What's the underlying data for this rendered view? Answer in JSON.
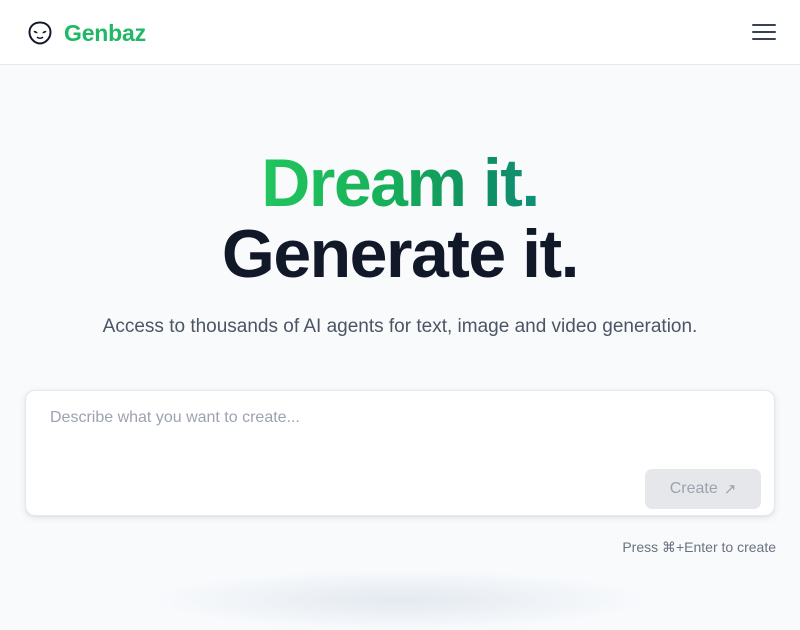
{
  "header": {
    "brand_name": "Genbaz",
    "logo_icon": "alien-face-icon",
    "menu_icon": "hamburger-menu-icon"
  },
  "hero": {
    "line1": "Dream it.",
    "line2": "Generate it.",
    "subtitle": "Access to thousands of AI agents for text, image and video generation."
  },
  "prompt": {
    "placeholder": "Describe what you want to create...",
    "value": "",
    "create_label": "Create",
    "create_icon": "arrow-up-right-icon",
    "create_arrow": "↗",
    "hint": "Press ⌘+Enter to create"
  },
  "colors": {
    "brand": "#1fb864",
    "heading_dark": "#111827",
    "button_disabled_bg": "#e5e7eb",
    "button_disabled_text": "#9ca3af"
  }
}
